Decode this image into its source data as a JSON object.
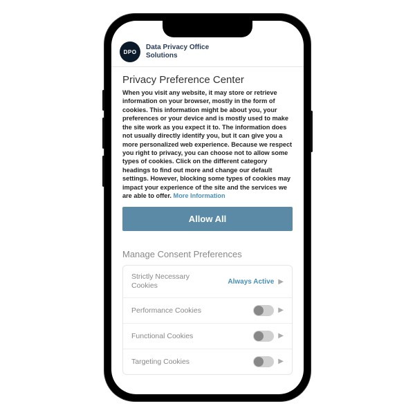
{
  "brand": {
    "line1": "Data Privacy Office",
    "line2": "Solutions",
    "logo_text": "DPO"
  },
  "title": "Privacy Preference Center",
  "description": "When you visit any website, it may store or retrieve information on your browser, mostly in the form of cookies. This information might be about you, your preferences or your device and is mostly used to make the site work as you expect it to. The information does not usually directly identify you, but it can give you a more personalized web experience. Because we respect you right to privacy, you can choose not to allow some types of cookies. Click on the different category headings to find out more and change our default settings. However, blocking some types of cookies may impact your experience of the site and the services we are able to offer.",
  "more_info": "More Information",
  "allow_all": "Allow All",
  "manage_title": "Manage Consent Preferences",
  "prefs": {
    "strict": {
      "label1": "Strictly Necessary",
      "label2": "Cookies",
      "status": "Always Active"
    },
    "performance": {
      "label": "Performance Cookies"
    },
    "functional": {
      "label": "Functional  Cookies"
    },
    "targeting": {
      "label": "Targeting Cookies"
    }
  }
}
